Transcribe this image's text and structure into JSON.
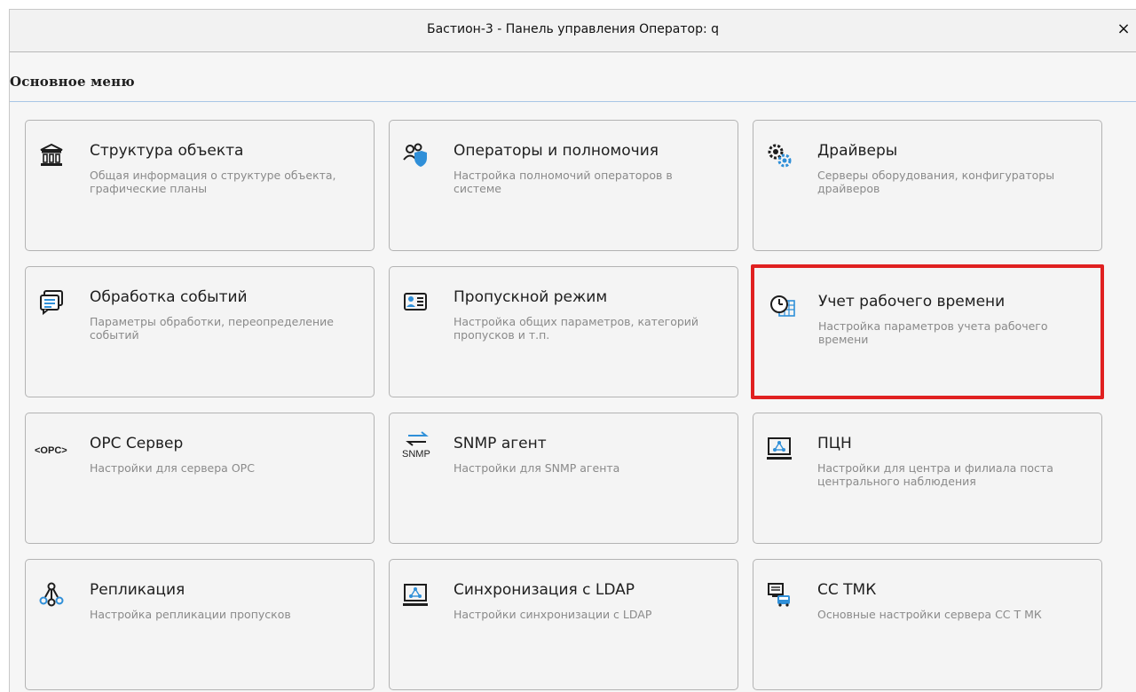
{
  "window": {
    "title": "Бастион-3 - Панель управления Оператор: q",
    "close_label": "×"
  },
  "section": {
    "label": "Основное меню"
  },
  "cards": [
    {
      "title": "Структура объекта",
      "desc": "Общая информация о структуре объекта, графические планы",
      "icon": "building-icon"
    },
    {
      "title": "Операторы и полномочия",
      "desc": "Настройка полномочий операторов в системе",
      "icon": "users-shield-icon"
    },
    {
      "title": "Драйверы",
      "desc": "Серверы оборудования, конфигураторы драйверов",
      "icon": "gears-icon"
    },
    {
      "title": "Обработка событий",
      "desc": "Параметры обработки, переопределение событий",
      "icon": "events-icon"
    },
    {
      "title": "Пропускной режим",
      "desc": "Настройка общих параметров, категорий пропусков и т.п.",
      "icon": "id-card-icon"
    },
    {
      "title": "Учет рабочего времени",
      "desc": "Настройка параметров учета рабочего времени",
      "icon": "clock-calendar-icon",
      "highlighted": true
    },
    {
      "title": "OPC Сервер",
      "desc": "Настройки для сервера OPC",
      "icon": "opc-icon",
      "icon_text": "<OPC>"
    },
    {
      "title": "SNMP агент",
      "desc": "Настройки для SNMP агента",
      "icon": "snmp-icon",
      "icon_text": "SNMP"
    },
    {
      "title": "ПЦН",
      "desc": "Настройки для центра и филиала поста центрального наблюдения",
      "icon": "monitor-network-icon"
    },
    {
      "title": "Репликация",
      "desc": "Настройка репликации пропусков",
      "icon": "replication-icon"
    },
    {
      "title": "Синхронизация с LDAP",
      "desc": "Настройки синхронизации с LDAP",
      "icon": "ldap-sync-icon"
    },
    {
      "title": "СС ТМК",
      "desc": "Основные настройки сервера СС Т МК",
      "icon": "bus-monitor-icon"
    }
  ],
  "colors": {
    "highlight": "#e02020",
    "icon_blue": "#2f8fd8",
    "icon_dark": "#1d1d1d"
  }
}
